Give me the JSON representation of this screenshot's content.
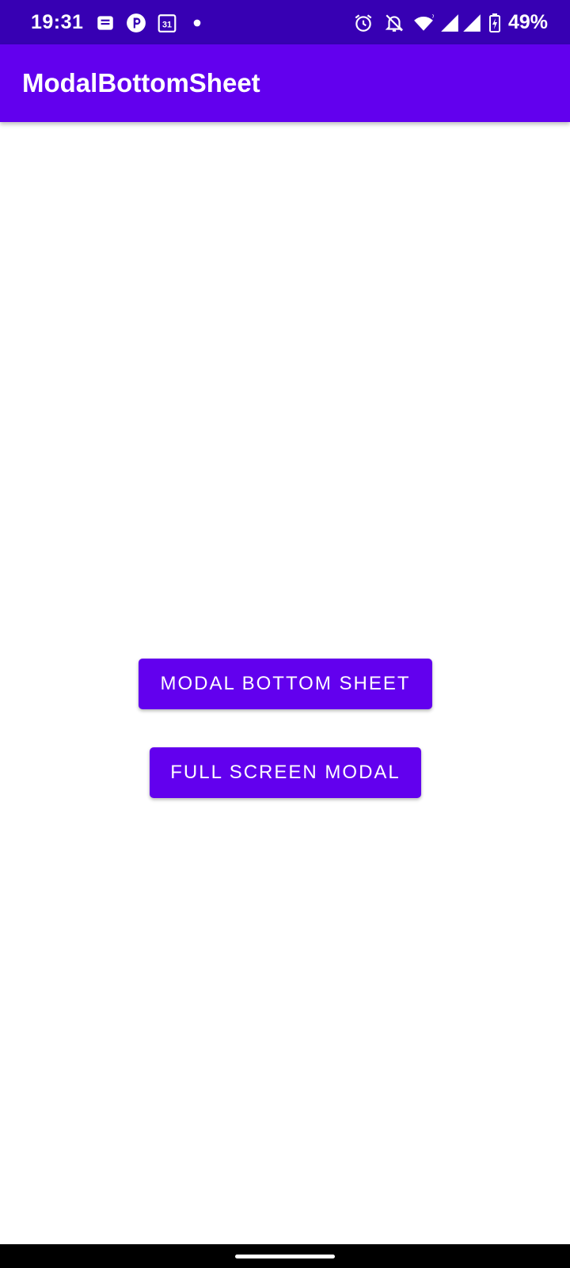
{
  "status_bar": {
    "time": "19:31",
    "battery_percent": "49%",
    "calendar_date": "31",
    "notification_icons": [
      "message-icon",
      "circle-p-icon",
      "calendar-icon",
      "dot-icon"
    ],
    "system_icons": [
      "alarm-icon",
      "notifications-off-icon",
      "wifi-icon",
      "signal-icon",
      "signal-icon",
      "battery-charging-icon"
    ],
    "background_color": "#3700b3"
  },
  "app_bar": {
    "title": "ModalBottomSheet",
    "background_color": "#6200ee"
  },
  "main": {
    "buttons": [
      {
        "label": "MODAL BOTTOM SHEET"
      },
      {
        "label": "FULL SCREEN MODAL"
      }
    ],
    "button_color": "#6200ee"
  }
}
